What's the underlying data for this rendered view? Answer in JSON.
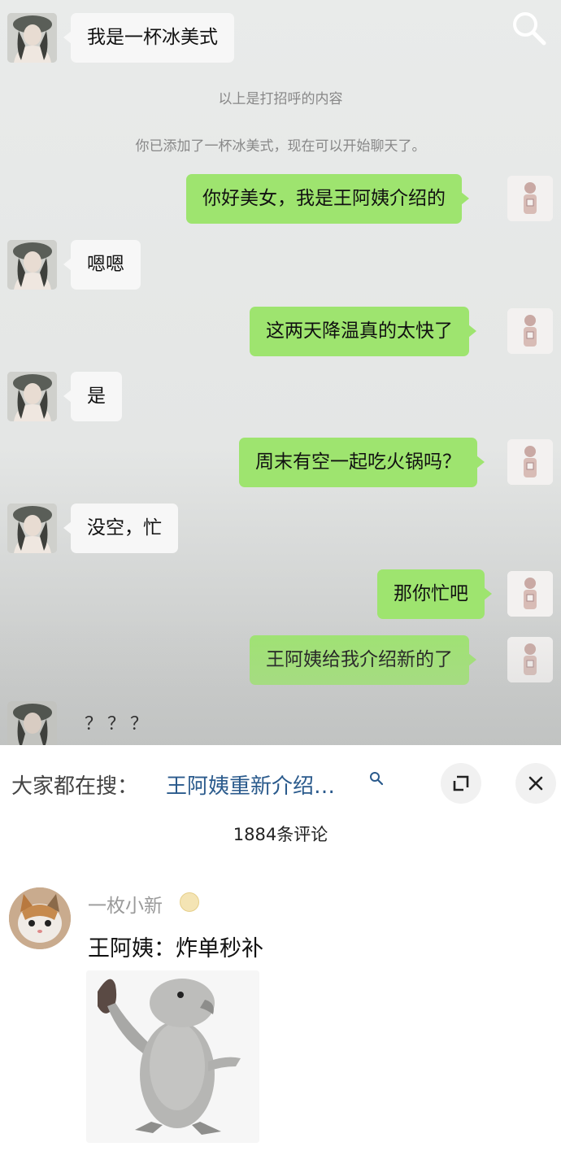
{
  "chat": {
    "messages": [
      {
        "side": "left",
        "text": "我是一杯冰美式"
      },
      {
        "side": "system",
        "text": "以上是打招呼的内容"
      },
      {
        "side": "system",
        "text": "你已添加了一杯冰美式，现在可以开始聊天了。"
      },
      {
        "side": "right",
        "text": "你好美女，我是王阿姨介绍的"
      },
      {
        "side": "left",
        "text": "嗯嗯"
      },
      {
        "side": "right",
        "text": "这两天降温真的太快了"
      },
      {
        "side": "left",
        "text": "是"
      },
      {
        "side": "right",
        "text": "周末有空一起吃火锅吗？"
      },
      {
        "side": "left",
        "text": "没空，忙"
      },
      {
        "side": "right",
        "text": "那你忙吧"
      },
      {
        "side": "right",
        "text": "王阿姨给我介绍新的了"
      },
      {
        "side": "left",
        "text": "？？？"
      }
    ],
    "search_icon": "search-icon"
  },
  "hot_search": {
    "label": "大家都在搜：",
    "query": "王阿姨重新介绍…",
    "query_icon": "search-icon",
    "expand_icon": "expand-icon",
    "close_icon": "close-icon"
  },
  "comments": {
    "count_label": "1884条评论",
    "items": [
      {
        "user": "一枚小新",
        "badge_icon": "level-badge-icon",
        "text": "王阿姨：炸单秒补",
        "sticker": "parrot-waving-sticker"
      }
    ]
  },
  "colors": {
    "self_bubble": "#9ee46f",
    "other_bubble": "#f7f7f7",
    "hot_query": "#2a5a8c"
  }
}
